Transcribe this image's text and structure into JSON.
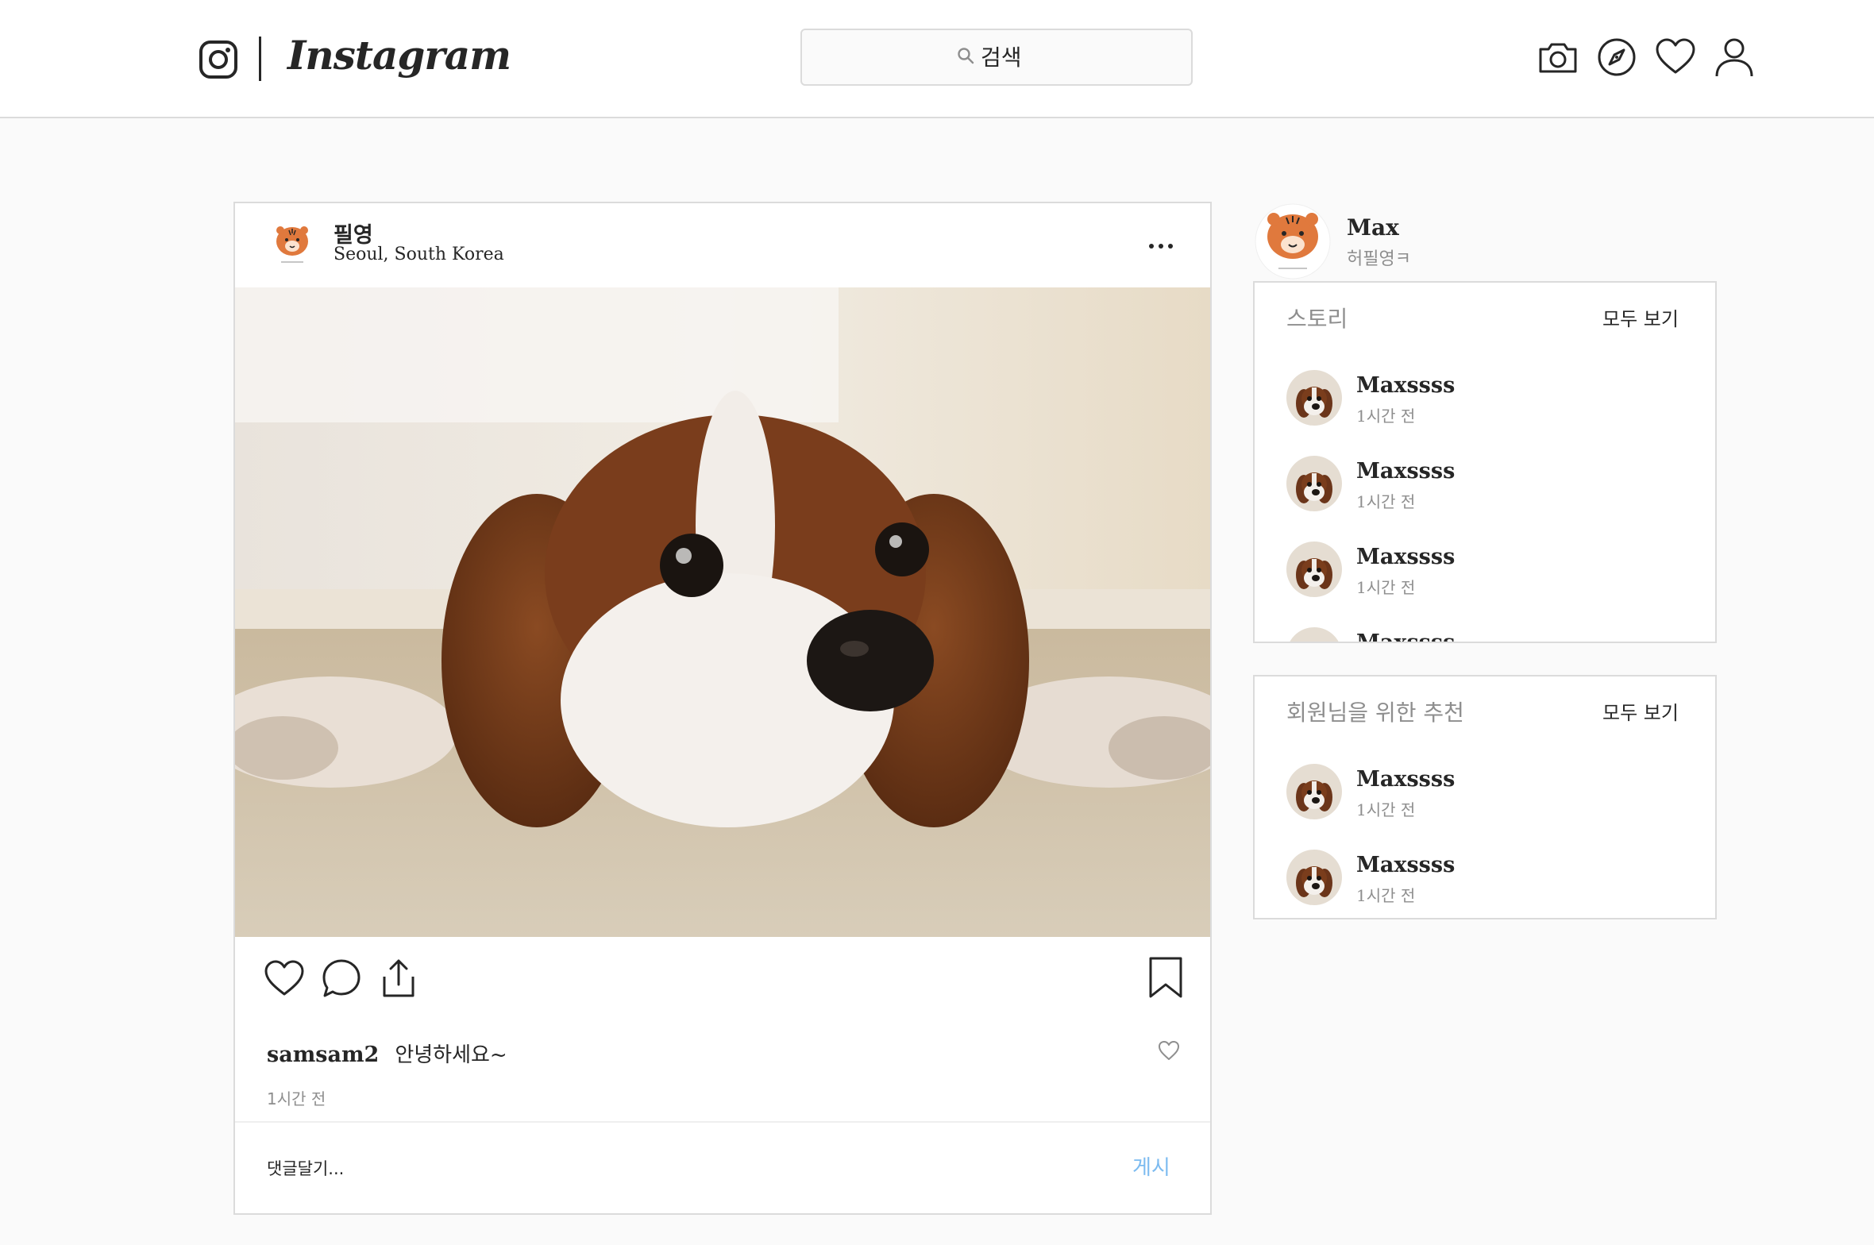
{
  "header": {
    "brand": "Instagram",
    "search_placeholder": "검색",
    "nav_icons": [
      "camera-icon",
      "compass-icon",
      "heart-icon",
      "profile-icon"
    ]
  },
  "post": {
    "author": "필영",
    "location": "Seoul, South Korea",
    "image_alt": "puppy",
    "caption_user": "samsam2",
    "caption_text": "안녕하세요~",
    "time": "1시간 전",
    "comment_placeholder": "댓글달기...",
    "post_button": "게시"
  },
  "profile": {
    "name": "Max",
    "subtitle": "허필영ㅋ"
  },
  "stories": {
    "title": "스토리",
    "see_all": "모두 보기",
    "items": [
      {
        "name": "Maxssss",
        "time": "1시간 전"
      },
      {
        "name": "Maxssss",
        "time": "1시간 전"
      },
      {
        "name": "Maxssss",
        "time": "1시간 전"
      },
      {
        "name": "Maxssss",
        "time": ""
      }
    ]
  },
  "recommend": {
    "title": "회원님을 위한 추천",
    "see_all": "모두 보기",
    "items": [
      {
        "name": "Maxssss",
        "time": "1시간 전"
      },
      {
        "name": "Maxssss",
        "time": "1시간 전"
      }
    ]
  },
  "colors": {
    "border": "#dbdbdb",
    "background": "#fafafa",
    "text": "#262626",
    "muted": "#8e8e8e",
    "link": "#7cbbf0"
  }
}
